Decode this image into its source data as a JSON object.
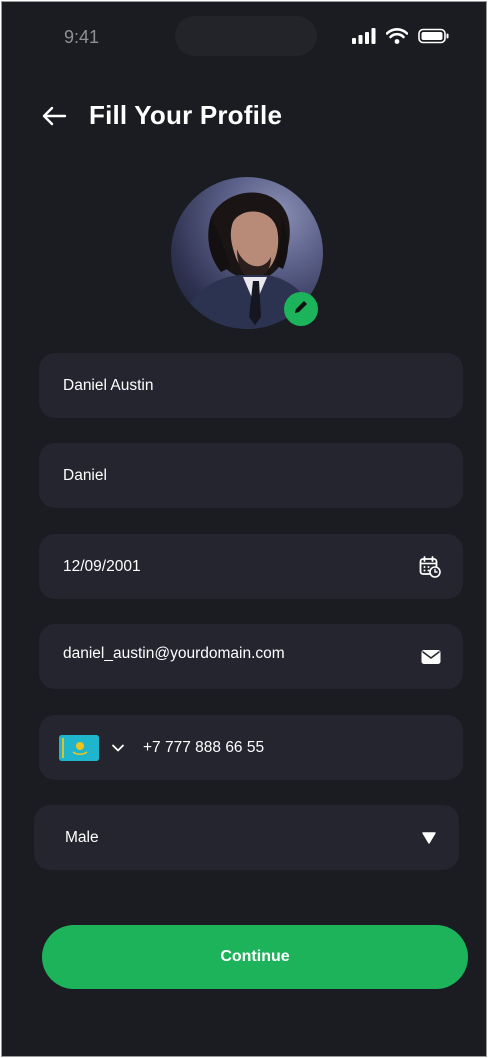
{
  "status_bar": {
    "time": "9:41"
  },
  "header": {
    "title": "Fill Your Profile",
    "back_icon": "arrow-left-icon"
  },
  "avatar": {
    "edit_icon": "pencil-icon"
  },
  "form": {
    "full_name": "Daniel Austin",
    "nickname": "Daniel",
    "date_of_birth": "12/09/2001",
    "email": "daniel_austin@yourdomain.com",
    "phone": {
      "country_flag": "kazakhstan-flag",
      "number": "+7 777 888 66 55"
    },
    "gender": "Male"
  },
  "actions": {
    "continue_label": "Continue"
  },
  "colors": {
    "background": "#1b1c21",
    "field": "#24252e",
    "accent": "#1db35a",
    "text": "#ffffff"
  }
}
